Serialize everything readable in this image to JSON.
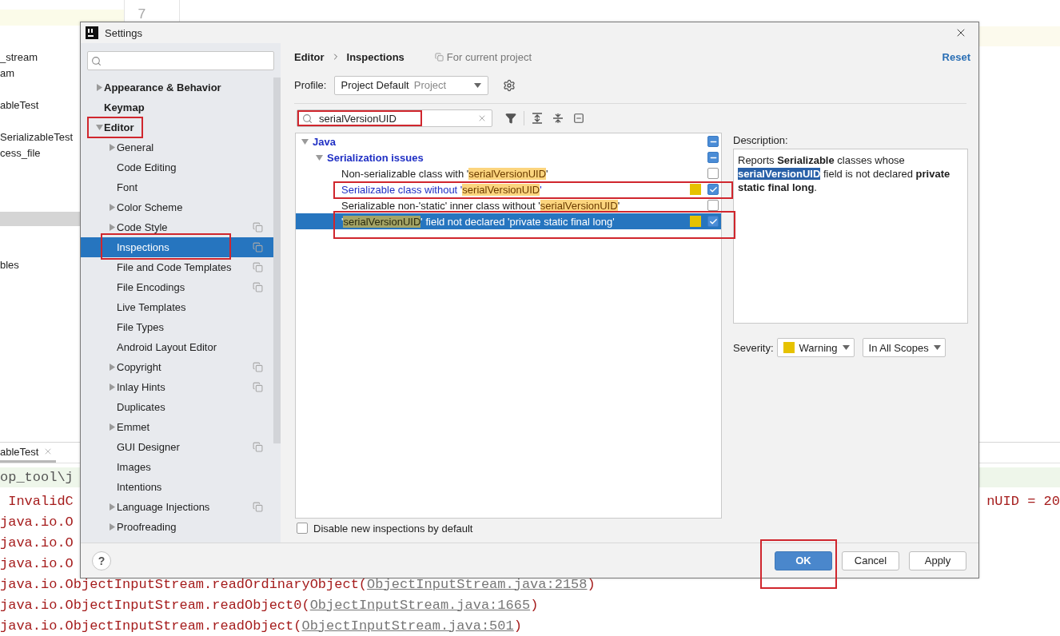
{
  "background": {
    "project_tree": [
      "_stream",
      "am",
      "ableTest",
      "SerializableTest",
      "cess_file",
      "bles"
    ],
    "line_number": "7",
    "run_tab": "ableTest",
    "console": [
      {
        "kind": "path",
        "text": "op_tool\\j"
      },
      {
        "kind": "error",
        "text": " InvalidC",
        "tail": "nUID = 20"
      },
      {
        "kind": "error",
        "text": "java.io.O"
      },
      {
        "kind": "error",
        "text": "java.io.O"
      },
      {
        "kind": "error",
        "text": "java.io.O"
      },
      {
        "kind": "trace",
        "text": "java.io.ObjectInputStream.readOrdinaryObject(",
        "link": "ObjectInputStream.java:2158",
        "after": ")"
      },
      {
        "kind": "trace",
        "text": "java.io.ObjectInputStream.readObject0(",
        "link": "ObjectInputStream.java:1665",
        "after": ")"
      },
      {
        "kind": "trace",
        "text": "java.io.ObjectInputStream.readObject(",
        "link": "ObjectInputStream.java:501",
        "after": ")"
      }
    ]
  },
  "dialog": {
    "title": "Settings",
    "sidebar": {
      "items": [
        {
          "label": "Appearance & Behavior",
          "expandable": true,
          "expanded": false,
          "selected": false,
          "scoped": false,
          "annotated": false
        },
        {
          "label": "Keymap",
          "expandable": false,
          "expanded": false,
          "selected": false,
          "scoped": false,
          "annotated": false
        },
        {
          "label": "Editor",
          "expandable": true,
          "expanded": true,
          "selected": false,
          "scoped": false,
          "annotated": true,
          "children": [
            {
              "label": "General",
              "expandable": true,
              "expanded": false,
              "selected": false,
              "scoped": false,
              "annotated": false
            },
            {
              "label": "Code Editing",
              "expandable": false,
              "expanded": false,
              "selected": false,
              "scoped": false,
              "annotated": false
            },
            {
              "label": "Font",
              "expandable": false,
              "expanded": false,
              "selected": false,
              "scoped": false,
              "annotated": false
            },
            {
              "label": "Color Scheme",
              "expandable": true,
              "expanded": false,
              "selected": false,
              "scoped": false,
              "annotated": false
            },
            {
              "label": "Code Style",
              "expandable": true,
              "expanded": false,
              "selected": false,
              "scoped": true,
              "annotated": false
            },
            {
              "label": "Inspections",
              "expandable": false,
              "expanded": false,
              "selected": true,
              "scoped": true,
              "annotated": true
            },
            {
              "label": "File and Code Templates",
              "expandable": false,
              "expanded": false,
              "selected": false,
              "scoped": true,
              "annotated": false
            },
            {
              "label": "File Encodings",
              "expandable": false,
              "expanded": false,
              "selected": false,
              "scoped": true,
              "annotated": false
            },
            {
              "label": "Live Templates",
              "expandable": false,
              "expanded": false,
              "selected": false,
              "scoped": false,
              "annotated": false
            },
            {
              "label": "File Types",
              "expandable": false,
              "expanded": false,
              "selected": false,
              "scoped": false,
              "annotated": false
            },
            {
              "label": "Android Layout Editor",
              "expandable": false,
              "expanded": false,
              "selected": false,
              "scoped": false,
              "annotated": false
            },
            {
              "label": "Copyright",
              "expandable": true,
              "expanded": false,
              "selected": false,
              "scoped": true,
              "annotated": false
            },
            {
              "label": "Inlay Hints",
              "expandable": true,
              "expanded": false,
              "selected": false,
              "scoped": true,
              "annotated": false
            },
            {
              "label": "Duplicates",
              "expandable": false,
              "expanded": false,
              "selected": false,
              "scoped": false,
              "annotated": false
            },
            {
              "label": "Emmet",
              "expandable": true,
              "expanded": false,
              "selected": false,
              "scoped": false,
              "annotated": false
            },
            {
              "label": "GUI Designer",
              "expandable": false,
              "expanded": false,
              "selected": false,
              "scoped": true,
              "annotated": false
            },
            {
              "label": "Images",
              "expandable": false,
              "expanded": false,
              "selected": false,
              "scoped": false,
              "annotated": false
            },
            {
              "label": "Intentions",
              "expandable": false,
              "expanded": false,
              "selected": false,
              "scoped": false,
              "annotated": false
            },
            {
              "label": "Language Injections",
              "expandable": true,
              "expanded": false,
              "selected": false,
              "scoped": true,
              "annotated": false
            },
            {
              "label": "Proofreading",
              "expandable": true,
              "expanded": false,
              "selected": false,
              "scoped": false,
              "annotated": false
            }
          ]
        }
      ]
    },
    "breadcrumb": [
      "Editor",
      "Inspections"
    ],
    "scope_note": "For current project",
    "reset": "Reset",
    "profile": {
      "label": "Profile:",
      "value": "Project Default",
      "hint": "Project"
    },
    "search": {
      "value": "serialVersionUID",
      "annotated": true
    },
    "inspections": [
      {
        "label": "Java",
        "mixed": true,
        "children": [
          {
            "label": "Serialization issues",
            "mixed": true,
            "children": [
              {
                "prefix": "Non-serializable class with '",
                "match": "serialVersionUID",
                "suffix": "'",
                "checked": false,
                "modified": false,
                "selected": false,
                "annotated": false
              },
              {
                "prefix": "Serializable class without '",
                "match": "serialVersionUID",
                "suffix": "'",
                "checked": true,
                "modified": true,
                "selected": false,
                "annotated": true
              },
              {
                "prefix": "Serializable non-'static' inner class without '",
                "match": "serialVersionUID",
                "suffix": "'",
                "checked": false,
                "modified": false,
                "selected": false,
                "annotated": false
              },
              {
                "prefix": "'",
                "match": "serialVersionUID",
                "suffix": "' field not declared 'private static final long'",
                "checked": true,
                "modified": false,
                "selected": true,
                "annotated": true
              }
            ]
          }
        ]
      }
    ],
    "description": {
      "label": "Description:",
      "before": "Reports **Serializable** classes whose",
      "selection": "serialVersionUID",
      "after": "field is not declared **private static final long**."
    },
    "severity": {
      "label": "Severity:",
      "value": "Warning",
      "color": "#e6c200",
      "scope": "In All Scopes"
    },
    "disable_new": {
      "label": "Disable new inspections by default",
      "checked": false
    },
    "help": "?",
    "buttons": [
      {
        "label": "OK",
        "primary": true,
        "annotated": true
      },
      {
        "label": "Cancel",
        "primary": false,
        "annotated": false
      },
      {
        "label": "Apply",
        "primary": false,
        "annotated": false
      }
    ]
  }
}
